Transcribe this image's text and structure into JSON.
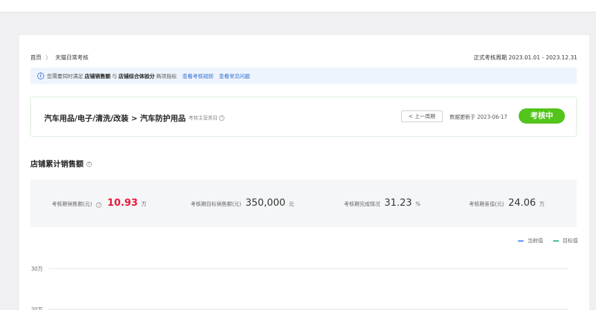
{
  "breadcrumb": {
    "home": "首页",
    "separator": "〉",
    "current": "天猫日常考核"
  },
  "period": "正式考核周期 2023.01.01 - 2023.12.31",
  "notice": {
    "icon": "info-icon",
    "prefix": "您需要同时满足",
    "metric1": "店铺销售额",
    "conj": "与",
    "metric2": "店铺综合体验分",
    "suffix": "两项指标",
    "link1": "查看考核规则",
    "link2": "查看常见问题"
  },
  "category": {
    "path": "汽车用品/电子/清洗/改装 > 汽车防护用品",
    "tag": "考核主营类目",
    "prev_button": "< 上一周期",
    "updated": "数据更新于 2023-06-17",
    "status": "考核中"
  },
  "section": {
    "title": "店铺累计销售额"
  },
  "stats": [
    {
      "label": "考核期销售额(元)",
      "value": "10.93",
      "unit": "万",
      "help": true,
      "highlight": true
    },
    {
      "label": "考核期目标销售额(元)",
      "value": "350,000",
      "unit": "元"
    },
    {
      "label": "考核期完成情况",
      "value": "31.23",
      "unit": "%"
    },
    {
      "label": "考核期差值(元)",
      "value": "24.06",
      "unit": "万"
    }
  ],
  "chart_data": {
    "type": "line",
    "legend": [
      {
        "name": "当前值",
        "color": "#5b8ff9"
      },
      {
        "name": "目标值",
        "color": "#3dbd87"
      }
    ],
    "y_ticks": [
      "30万",
      "20万"
    ],
    "legend_position": "top-right",
    "grid": true
  },
  "colors": {
    "accent_green": "#52c41a",
    "highlight_red": "#e8193c",
    "link_blue": "#2f6fd0"
  }
}
